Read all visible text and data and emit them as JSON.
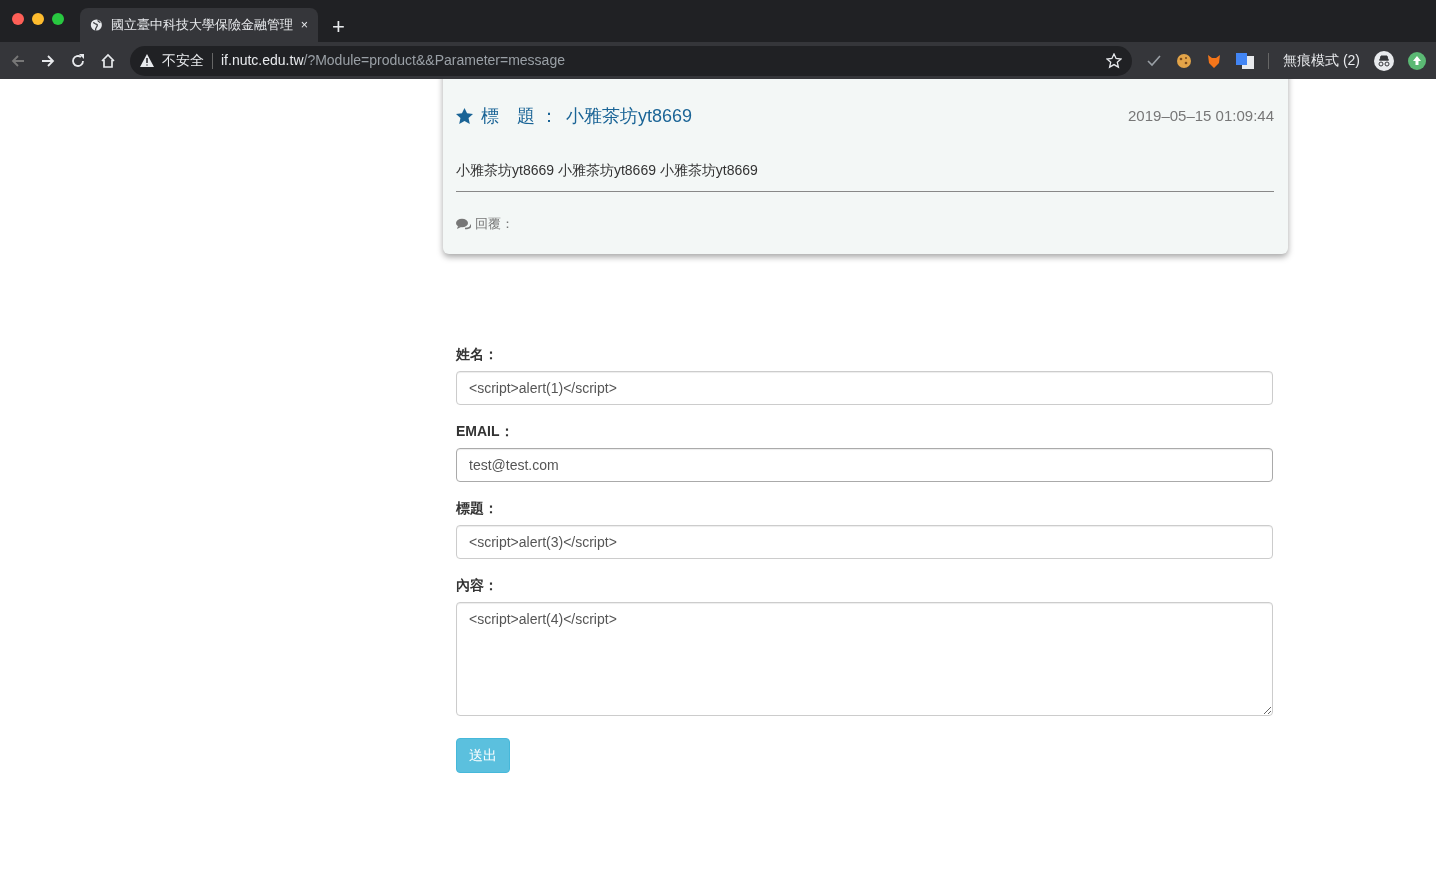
{
  "browser": {
    "tab_title": "國立臺中科技大學保險金融管理",
    "tab_close": "×",
    "new_tab": "+",
    "security_label": "不安全",
    "url_host": "if.nutc.edu.tw",
    "url_path": "/?Module=product&&Parameter=message",
    "profile_label": "無痕模式 (2)"
  },
  "message": {
    "title_label": "標　題 ：",
    "title": "小雅茶坊yt8669",
    "date": "2019–05–15 01:09:44",
    "body": "小雅茶坊yt8669 小雅茶坊yt8669 小雅茶坊yt8669",
    "reply_label": "回覆："
  },
  "form": {
    "fields": [
      {
        "kind": "input",
        "label": "姓名：",
        "value": "<script>alert(1)</script>",
        "focused": false
      },
      {
        "kind": "input",
        "label": "EMAIL：",
        "value": "test@test.com",
        "focused": true
      },
      {
        "kind": "input",
        "label": "標題：",
        "value": "<script>alert(3)</script>",
        "focused": false
      },
      {
        "kind": "textarea",
        "label": "內容：",
        "value": "<script>alert(4)</script>",
        "focused": false
      }
    ],
    "submit": "送出"
  }
}
